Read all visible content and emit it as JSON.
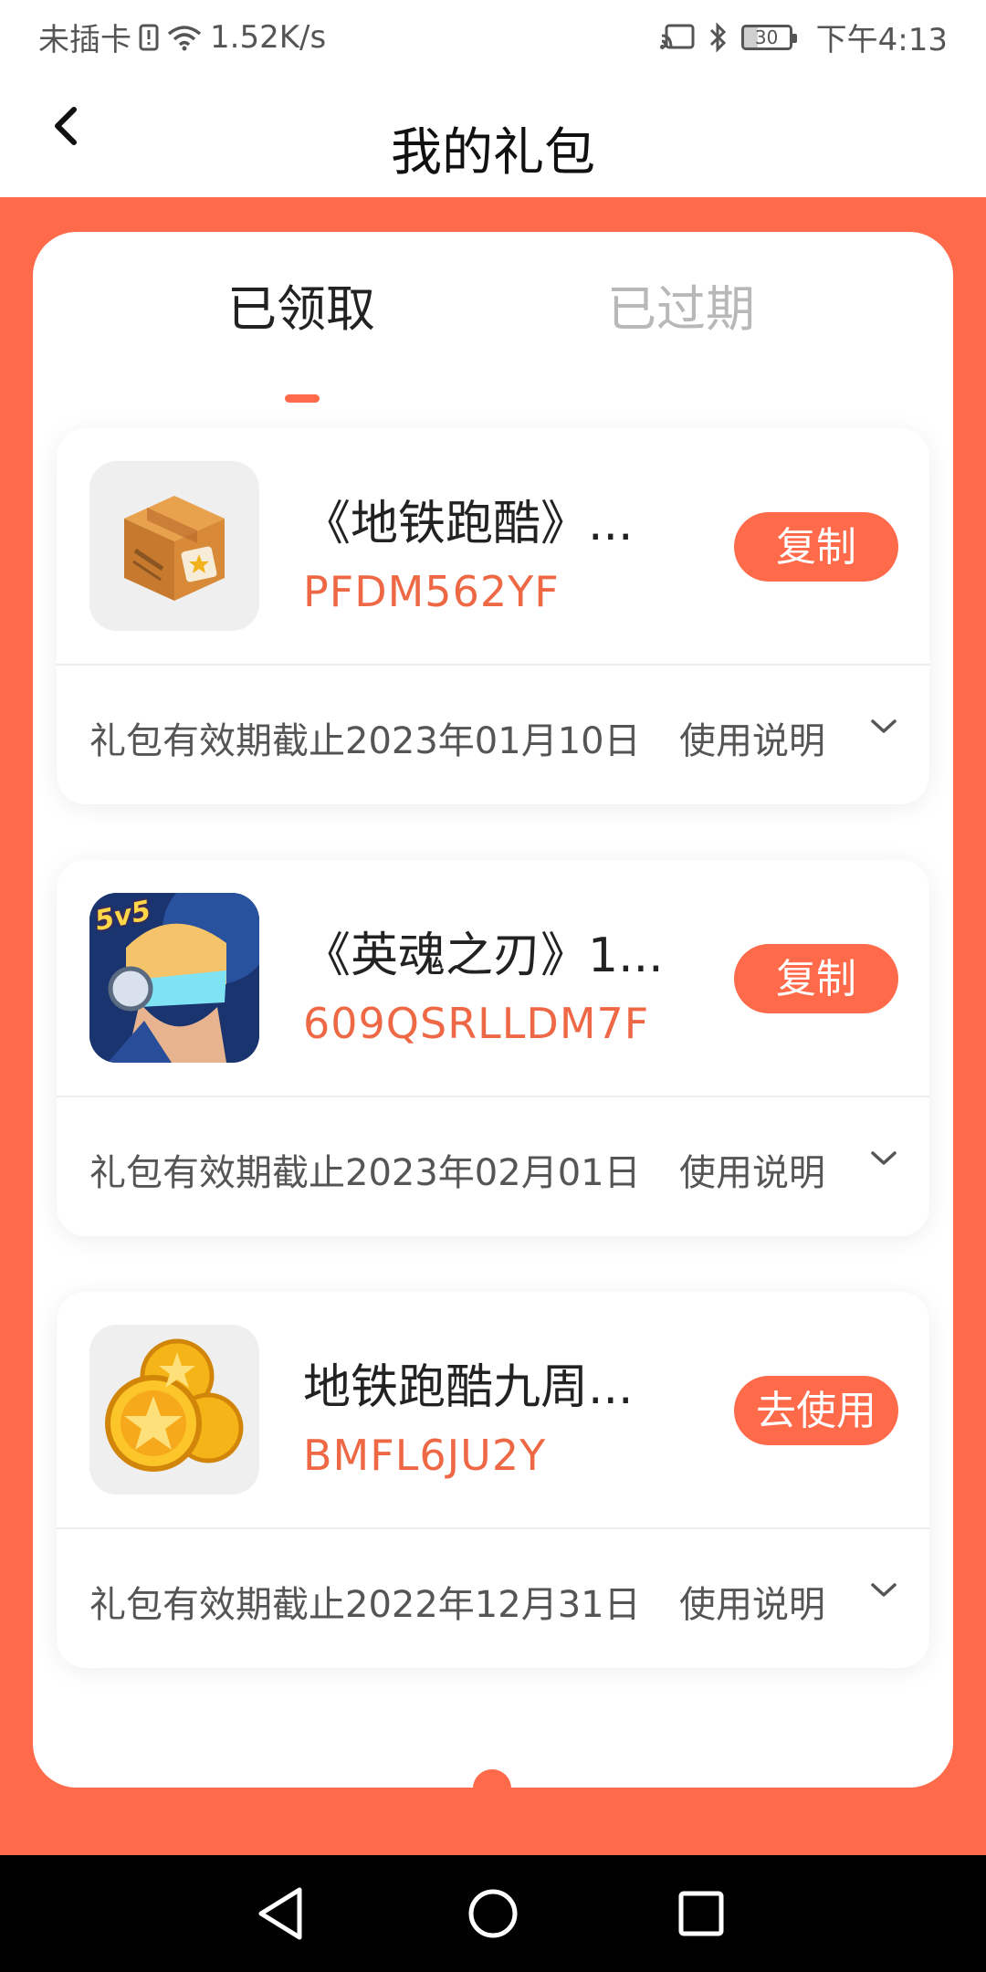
{
  "status_bar": {
    "carrier": "未插卡",
    "speed": "1.52K/s",
    "battery": "30",
    "time": "下午4:13"
  },
  "header": {
    "title": "我的礼包"
  },
  "tabs": [
    {
      "label": "已领取",
      "active": true
    },
    {
      "label": "已过期",
      "active": false
    }
  ],
  "gifts": [
    {
      "name": "《地铁跑酷》...",
      "code": "PFDM562YF",
      "action": "复制",
      "expiry": "礼包有效期截止2023年01月10日",
      "usage": "使用说明",
      "icon": "gift-box-icon"
    },
    {
      "name": "《英魂之刃》1...",
      "code": "609QSRLLDM7F",
      "action": "复制",
      "expiry": "礼包有效期截止2023年02月01日",
      "usage": "使用说明",
      "icon": "game-hero-icon",
      "icon_badge": "5v5"
    },
    {
      "name": "地铁跑酷九周...",
      "code": "BMFL6JU2Y",
      "action": "去使用",
      "expiry": "礼包有效期截止2022年12月31日",
      "usage": "使用说明",
      "icon": "gold-coins-icon"
    }
  ],
  "colors": {
    "accent": "#ff6a4a",
    "code": "#ee6846",
    "text_dark": "#222222",
    "text_muted": "#b8b8b8"
  }
}
